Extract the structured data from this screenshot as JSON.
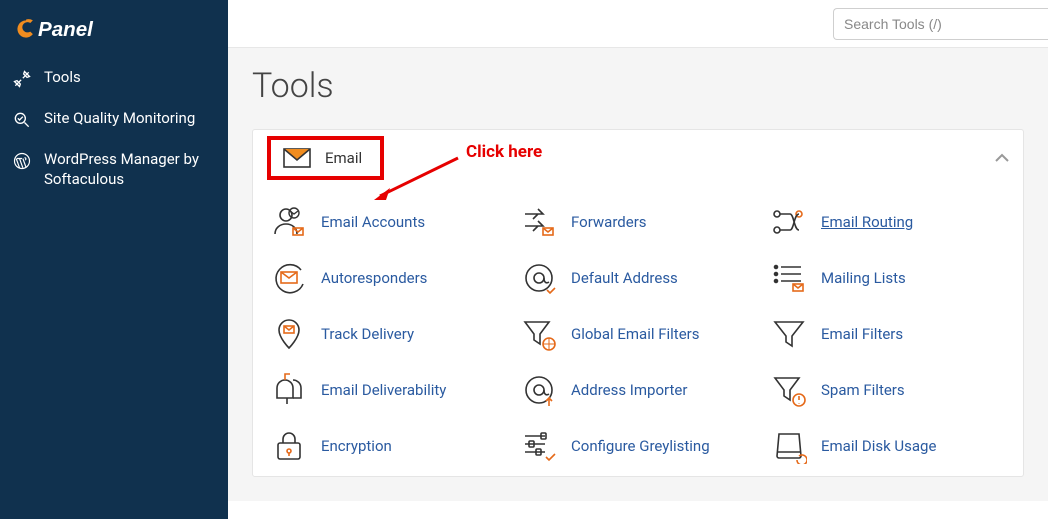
{
  "brand": "cPanel",
  "sidebar": {
    "items": [
      {
        "label": "Tools"
      },
      {
        "label": "Site Quality Monitoring"
      },
      {
        "label": "WordPress Manager by Softaculous"
      }
    ]
  },
  "search": {
    "placeholder": "Search Tools (/)"
  },
  "page": {
    "title": "Tools"
  },
  "annotation": {
    "text": "Click here"
  },
  "email_panel": {
    "title": "Email",
    "tools": [
      {
        "label": "Email Accounts"
      },
      {
        "label": "Forwarders"
      },
      {
        "label": "Email Routing"
      },
      {
        "label": "Autoresponders"
      },
      {
        "label": "Default Address"
      },
      {
        "label": "Mailing Lists"
      },
      {
        "label": "Track Delivery"
      },
      {
        "label": "Global Email Filters"
      },
      {
        "label": "Email Filters"
      },
      {
        "label": "Email Deliverability"
      },
      {
        "label": "Address Importer"
      },
      {
        "label": "Spam Filters"
      },
      {
        "label": "Encryption"
      },
      {
        "label": "Configure Greylisting"
      },
      {
        "label": "Email Disk Usage"
      }
    ]
  },
  "colors": {
    "sidebar_bg": "#10314e",
    "link": "#2a5aa0",
    "accent": "#e56a1a",
    "highlight": "#e60000"
  }
}
